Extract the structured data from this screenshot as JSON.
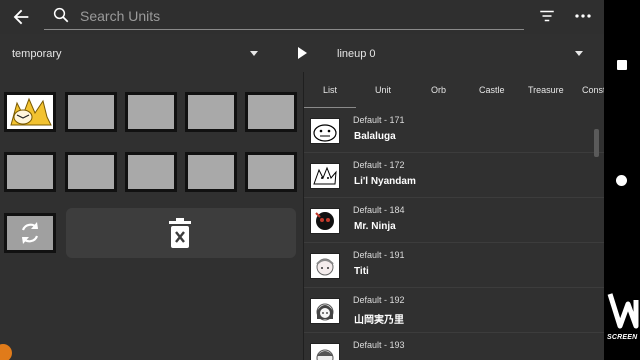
{
  "search": {
    "placeholder": "Search Units"
  },
  "toolbar": {
    "back_icon": "arrow-left-icon",
    "filter_icon": "filter-icon",
    "more_icon": "more-vertical-icon"
  },
  "dropdowns": {
    "pack": "temporary",
    "lineup": "lineup 0"
  },
  "lineup": {
    "slots_row1": [
      "unit",
      "empty",
      "empty",
      "empty",
      "empty"
    ],
    "slots_row2": [
      "empty",
      "empty",
      "empty",
      "empty",
      "empty"
    ],
    "rotate_icon": "rotate-icon",
    "trash_icon": "trash-icon"
  },
  "tabs": [
    "List",
    "Unit",
    "Orb",
    "Castle",
    "Treasure",
    "Const"
  ],
  "units": [
    {
      "sub": "Default - 171",
      "name": "Balaluga"
    },
    {
      "sub": "Default - 172",
      "name": "Li'l Nyandam"
    },
    {
      "sub": "Default - 184",
      "name": "Mr. Ninja"
    },
    {
      "sub": "Default - 191",
      "name": "Titi"
    },
    {
      "sub": "Default - 192",
      "name": "山岡実乃里"
    },
    {
      "sub": "Default - 193",
      "name": ""
    }
  ],
  "watermark": "SCREEN",
  "colors": {
    "accent_orange": "#e07b1a",
    "slot_gray": "#a9a9a9",
    "background": "#303030"
  }
}
